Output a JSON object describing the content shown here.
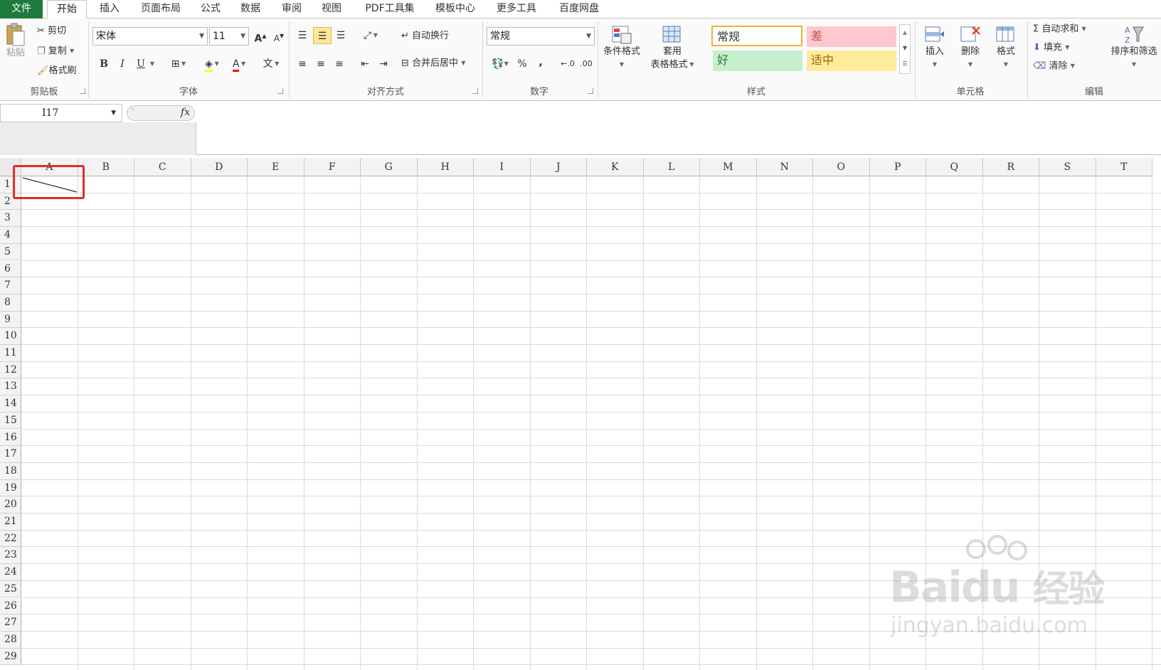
{
  "tabs": {
    "file": "文件",
    "items": [
      "开始",
      "插入",
      "页面布局",
      "公式",
      "数据",
      "审阅",
      "视图",
      "PDF工具集",
      "模板中心",
      "更多工具",
      "百度网盘"
    ]
  },
  "ribbon": {
    "clipboard": {
      "paste": "粘贴",
      "cut": "剪切",
      "copy": "复制",
      "format_painter": "格式刷",
      "label": "剪贴板"
    },
    "font": {
      "name": "宋体",
      "size": "11",
      "bold": "B",
      "italic": "I",
      "underline": "U",
      "label": "字体"
    },
    "align": {
      "wrap": "自动换行",
      "merge": "合并后居中",
      "label": "对齐方式"
    },
    "number": {
      "format": "常规",
      "percent": "%",
      "comma": ",",
      "label": "数字"
    },
    "styles": {
      "cond_format": "条件格式",
      "table_format_1": "套用",
      "table_format_2": "表格格式",
      "normal": "常规",
      "bad": "差",
      "good": "好",
      "neutral": "适中",
      "label": "样式"
    },
    "cells": {
      "insert": "插入",
      "delete": "删除",
      "format": "格式",
      "label": "单元格"
    },
    "edit": {
      "autosum": "自动求和",
      "fill": "填充",
      "clear": "清除",
      "sort_filter": "排序和筛选",
      "label": "编辑"
    }
  },
  "formula_bar": {
    "name_box": "I17",
    "fx": "fx"
  },
  "sheet": {
    "columns": [
      "A",
      "B",
      "C",
      "D",
      "E",
      "F",
      "G",
      "H",
      "I",
      "J",
      "K",
      "L",
      "M",
      "N",
      "O",
      "P",
      "Q",
      "R",
      "S",
      "T"
    ],
    "rows": [
      "1",
      "2",
      "3",
      "4",
      "5",
      "6",
      "7",
      "8",
      "9",
      "10",
      "11",
      "12",
      "13",
      "14",
      "15",
      "16",
      "17",
      "18",
      "19",
      "20",
      "21",
      "22",
      "23",
      "24",
      "25",
      "26",
      "27",
      "28",
      "29"
    ]
  },
  "colors": {
    "file_tab": "#1e7a3c",
    "highlight": "#e52a2a",
    "bad_bg": "#ffc7ce",
    "good_bg": "#c6efce",
    "neutral_bg": "#ffeb9c"
  },
  "watermark": {
    "brand": "Bai",
    "brand2": "du",
    "cn": "经验",
    "url": "jingyan.baidu.com"
  }
}
